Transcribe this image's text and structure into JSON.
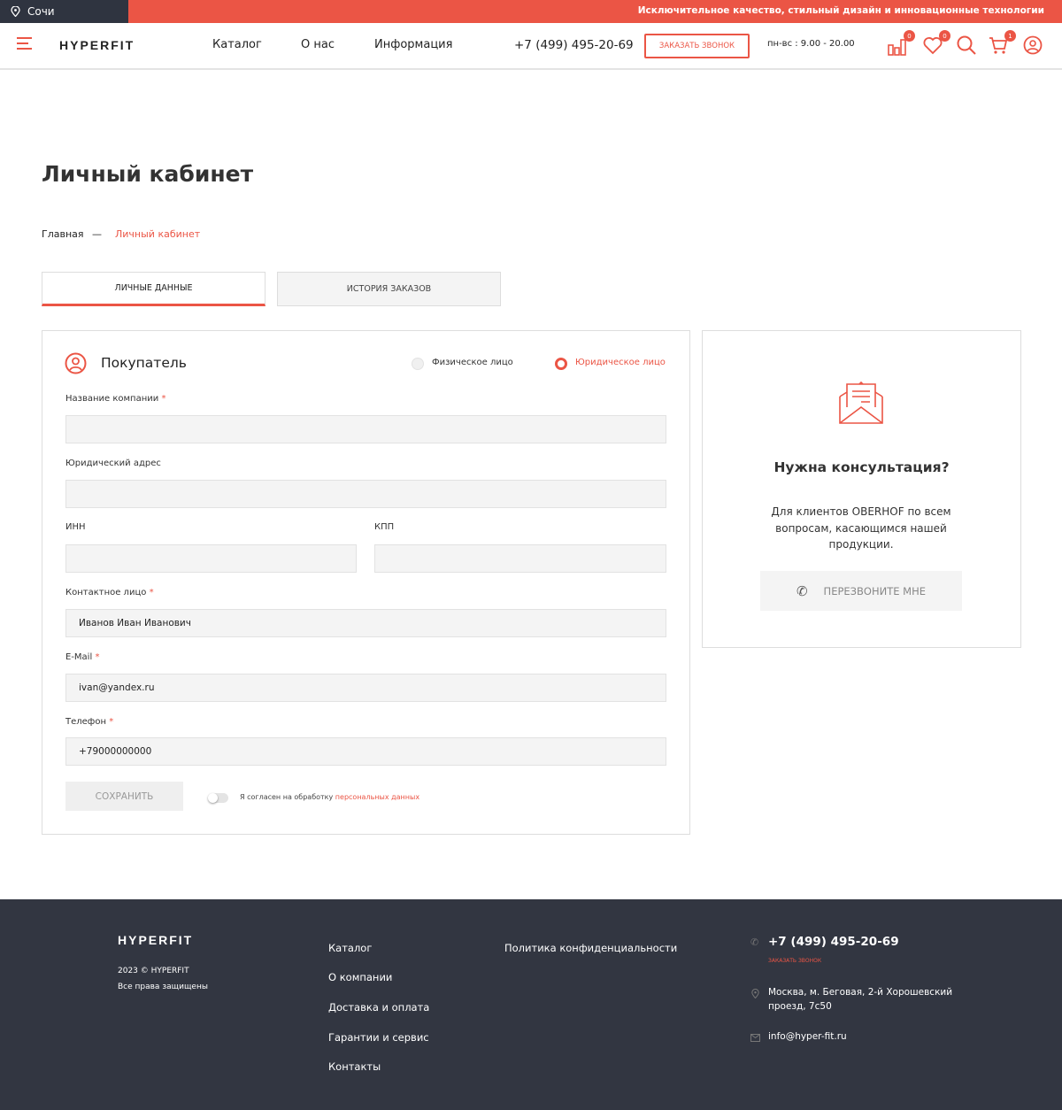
{
  "topbar": {
    "city": "Сочи",
    "slogan": "Исключительное качество, стильный дизайн и инновационные технологии"
  },
  "header": {
    "logo": "HYPERFIT",
    "nav": [
      "Каталог",
      "О нас",
      "Информация"
    ],
    "phone": "+7 (499) 495-20-69",
    "call_button": "ЗАКАЗАТЬ ЗВОНОК",
    "hours": "пн-вс : 9.00 - 20.00",
    "compare_count": "0",
    "favorites_count": "0",
    "cart_count": "1"
  },
  "page": {
    "title": "Личный кабинет",
    "breadcrumb": {
      "home": "Главная",
      "separator": "—",
      "current": "Личный кабинет"
    },
    "tabs": [
      "ЛИЧНЫЕ ДАННЫЕ",
      "ИСТОРИЯ ЗАКАЗОВ"
    ]
  },
  "form": {
    "title": "Покупатель",
    "radio_individual": "Физическое лицо",
    "radio_legal": "Юридическое лицо",
    "fields": {
      "company": {
        "label": "Название компании",
        "value": ""
      },
      "address": {
        "label": "Юридический адрес",
        "value": ""
      },
      "inn": {
        "label": "ИНН",
        "value": ""
      },
      "kpp": {
        "label": "КПП",
        "value": ""
      },
      "contact": {
        "label": "Контактное лицо",
        "value": "Иванов Иван Иванович"
      },
      "email": {
        "label": "E-Mail",
        "value": "ivan@yandex.ru"
      },
      "phone": {
        "label": "Телефон",
        "value": "+79000000000"
      }
    },
    "required_mark": "*",
    "save": "СОХРАНИТЬ",
    "consent_text": "Я согласен на обработку ",
    "consent_link": "персональных данных"
  },
  "consult": {
    "title": "Нужна консультация?",
    "text": "Для клиентов OBERHOF по всем вопросам, касающимся нашей продукции.",
    "button": "ПЕРЕЗВОНИТЕ МНЕ"
  },
  "footer": {
    "logo": "HYPERFIT",
    "copyright": "2023 © HYPERFIT",
    "rights": "Все права защищены",
    "links": [
      "Каталог",
      "О компании",
      "Доставка и оплата",
      "Гарантии и сервис",
      "Контакты"
    ],
    "policy": "Политика конфиденциальности",
    "phone": "+7 (499) 495-20-69",
    "call": "ЗАКАЗАТЬ ЗВОНОК",
    "address": "Москва, м. Беговая, 2-й Хорошевский проезд, 7с50",
    "email": "info@hyper-fit.ru"
  },
  "colors": {
    "accent": "#eb5545",
    "dark": "#323641"
  }
}
